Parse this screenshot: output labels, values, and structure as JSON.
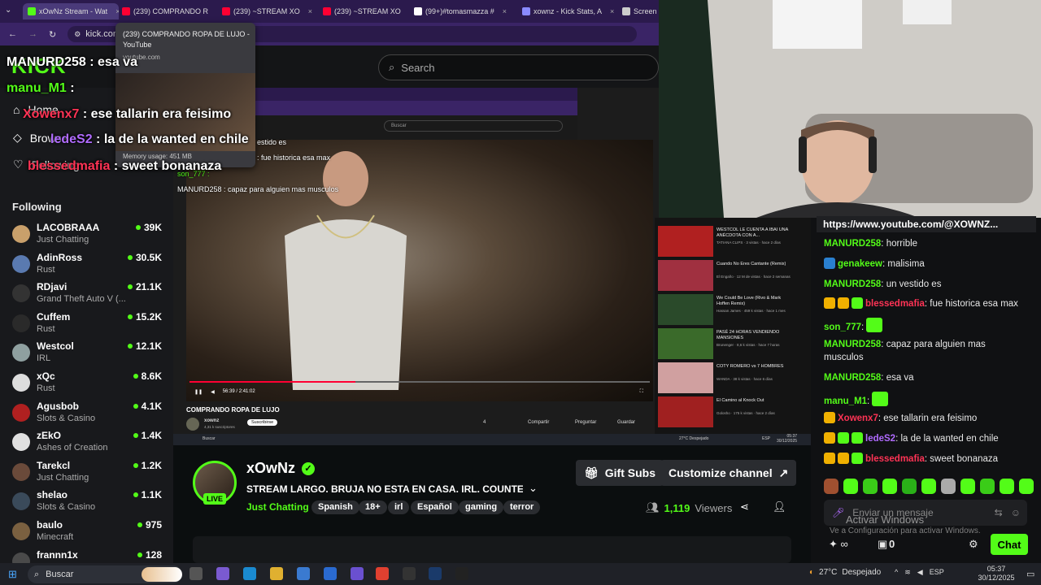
{
  "browser": {
    "tabs": [
      {
        "label": "xOwNz Stream - Wat",
        "color": "#53fc18"
      },
      {
        "label": "(239) COMPRANDO R",
        "color": "#ff0033"
      },
      {
        "label": "(239) ~STREAM XO",
        "color": "#ff0033"
      },
      {
        "label": "(239) ~STREAM XO",
        "color": "#ff0033"
      },
      {
        "label": "(99+)#tomasmazza #",
        "color": "#ffffff"
      },
      {
        "label": "xownz - Kick Stats, A",
        "color": "#8a8aff"
      },
      {
        "label": "Screen",
        "color": "#cccccc"
      }
    ],
    "url": "kick.com"
  },
  "tooltip": {
    "title": "(239) COMPRANDO ROPA DE LUJO - YouTube",
    "domain": "youtube.com",
    "memory": "Memory usage: 451 MB"
  },
  "kick": {
    "logo": "KICK",
    "search_placeholder": "Search"
  },
  "sidebar": {
    "nav": [
      {
        "label": "Home"
      },
      {
        "label": "Browse"
      },
      {
        "label": "Following"
      }
    ],
    "following_title": "Following",
    "channels": [
      {
        "name": "LACOBRAAA",
        "category": "Just Chatting",
        "viewers": "39K",
        "color": "#c9a06b"
      },
      {
        "name": "AdinRoss",
        "category": "Rust",
        "viewers": "30.5K",
        "color": "#5a7ab0"
      },
      {
        "name": "RDjavi",
        "category": "Grand Theft Auto V (...",
        "viewers": "21.1K",
        "color": "#333333"
      },
      {
        "name": "Cuffem",
        "category": "Rust",
        "viewers": "15.2K",
        "color": "#2a2a2a"
      },
      {
        "name": "Westcol",
        "category": "IRL",
        "viewers": "12.1K",
        "color": "#8fa0a0"
      },
      {
        "name": "xQc",
        "category": "Rust",
        "viewers": "8.6K",
        "color": "#dddddd"
      },
      {
        "name": "Agusbob",
        "category": "Slots & Casino",
        "viewers": "4.1K",
        "color": "#b02020"
      },
      {
        "name": "zEkO",
        "category": "Ashes of Creation",
        "viewers": "1.4K",
        "color": "#e0e0e0"
      },
      {
        "name": "Tarekcl",
        "category": "Just Chatting",
        "viewers": "1.2K",
        "color": "#6a4a3a"
      },
      {
        "name": "shelao",
        "category": "Slots & Casino",
        "viewers": "1.1K",
        "color": "#3a4a5a"
      },
      {
        "name": "baulo",
        "category": "Minecraft",
        "viewers": "975",
        "color": "#7a6040"
      },
      {
        "name": "frannn1x",
        "category": "",
        "viewers": "128",
        "color": "#4a4a4a"
      }
    ]
  },
  "overlay_chat": [
    {
      "user": "MANURD258",
      "text": ": esa va",
      "color": "#ffffff"
    },
    {
      "user": "manu_M1",
      "text": ":",
      "color": "#53fc18"
    },
    {
      "user": "Xowenx7",
      "text": ": ese tallarin era feisimo",
      "color": "#ff3355"
    },
    {
      "user": "ledeS2",
      "text": ": la de la wanted en chile",
      "color": "#b06bff"
    },
    {
      "user": "blessedmafia",
      "text": ": sweet bonanaza",
      "color": "#ff3355"
    }
  ],
  "video": {
    "inner_search": "Buscar",
    "time": "56:39 / 2:41:02",
    "title": "COMPRANDO ROPA DE LUJO",
    "channel": "xownz",
    "subs": "4,31 k suscriptores",
    "subscribe": "Suscribirse",
    "actions": [
      "4",
      "Compartir",
      "Preguntar",
      "Guardar"
    ],
    "overlay_lines": [
      "estido es",
      ": fue historica esa max",
      "son_777 :",
      "MANURD258 : capaz para alguien mas musculos"
    ],
    "related": [
      {
        "title": "WESTCOL LE CUENTA A IBAI UNA ANÉCDOTA CON A...",
        "sub": "TATIANA CLIPS · 3 vistas · hace 2 días",
        "color": "#b02020"
      },
      {
        "title": "Cuando No Eres Cantante (Remix)",
        "sub": "El Engaño · 12 M de vistas · hace 2 semanas",
        "color": "#a03040"
      },
      {
        "title": "We Could Be Love (Rivo & Mark Hoffen Remix)",
        "sub": "Hassan James · 459 k vistas · hace 1 mes",
        "color": "#2a4a2a"
      },
      {
        "title": "PASÉ 24 HORAS VENDIENDO MANSIONES",
        "sub": "Brunenger · 8,6 k vistas · hace 7 horas",
        "color": "#3a6a2a"
      },
      {
        "title": "COTY ROMERO vs 7 HOMBRES",
        "sub": "WANDA · 38 k vistas · hace 6 días",
        "color": "#d0a0a0"
      },
      {
        "title": "El Camino al Knock Out",
        "sub": "Golosho · 175 k vistas · hace 2 días",
        "color": "#a02020"
      }
    ],
    "inner_taskbar": {
      "search": "Buscar",
      "weather": "27°C Despejado",
      "time": "05:37",
      "date": "30/12/2025",
      "lang": "ESP"
    }
  },
  "chat": {
    "pinned": "https://www.youtube.com/@XOWNZ...",
    "messages": [
      {
        "user": "MANURD258",
        "text": "horrible",
        "color": "#53fc18",
        "badges": []
      },
      {
        "user": "genakeew",
        "text": "malisima",
        "color": "#53fc18",
        "badges": [
          "#2a80d0"
        ]
      },
      {
        "user": "MANURD258",
        "text": "un vestido es",
        "color": "#53fc18",
        "badges": []
      },
      {
        "user": "blessedmafia",
        "text": "fue historica esa max",
        "color": "#ff3355",
        "badges": [
          "#f0b000",
          "#f0b000",
          "#53fc18"
        ]
      },
      {
        "user": "son_777",
        "text": "",
        "color": "#53fc18",
        "badges": []
      },
      {
        "user": "MANURD258",
        "text": "capaz para alguien mas musculos",
        "color": "#53fc18",
        "badges": []
      },
      {
        "user": "MANURD258",
        "text": "esa va",
        "color": "#53fc18",
        "badges": []
      },
      {
        "user": "manu_M1",
        "text": "",
        "color": "#53fc18",
        "badges": []
      },
      {
        "user": "Xowenx7",
        "text": "ese tallarin era feisimo",
        "color": "#ff3355",
        "badges": [
          "#f0b000"
        ]
      },
      {
        "user": "ledeS2",
        "text": "la de la wanted en chile",
        "color": "#b06bff",
        "badges": [
          "#f0b000",
          "#53fc18",
          "#53fc18"
        ]
      },
      {
        "user": "blessedmafia",
        "text": "sweet bonanaza",
        "color": "#ff3355",
        "badges": [
          "#f0b000",
          "#f0b000",
          "#53fc18"
        ]
      }
    ],
    "input_placeholder": "Enviar un mensaje",
    "watermark_line1": "Activar Windows",
    "watermark_line2": "Ve a Configuración para activar Windows.",
    "points": "0",
    "send_label": "Chat"
  },
  "stream": {
    "streamer": "xOwNz",
    "title": "STREAM LARGO. BRUJA NO ESTA EN CASA. IRL. COUNTE...",
    "category": "Just Chatting",
    "tags": [
      "Spanish",
      "18+",
      "irl",
      "Español",
      "gaming",
      "terror"
    ],
    "gift_subs": "Gift Subs",
    "customize": "Customize channel",
    "viewers": "1,119",
    "viewers_label": "Viewers",
    "live": "LIVE"
  },
  "taskbar": {
    "search": "Buscar",
    "weather": "27°C",
    "weather_desc": "Despejado",
    "lang": "ESP",
    "time": "05:37",
    "date": "30/12/2025"
  }
}
